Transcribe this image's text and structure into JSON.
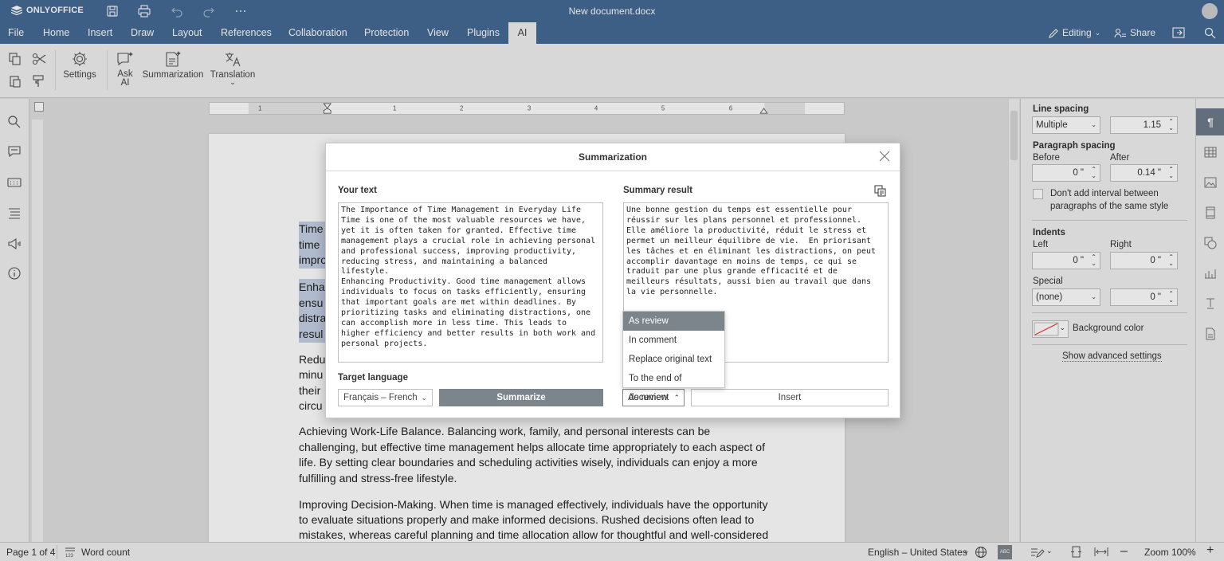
{
  "app": {
    "name": "ONLYOFFICE",
    "doc_title": "New document.docx"
  },
  "menu": {
    "tabs": [
      "File",
      "Home",
      "Insert",
      "Draw",
      "Layout",
      "References",
      "Collaboration",
      "Protection",
      "View",
      "Plugins",
      "AI"
    ],
    "active_tab": "AI",
    "editing_label": "Editing",
    "share_label": "Share"
  },
  "toolbar": {
    "settings": "Settings",
    "ask_ai_1": "Ask",
    "ask_ai_2": "AI",
    "summarization": "Summarization",
    "translation": "Translation"
  },
  "ruler": {
    "numbers": [
      "1",
      "1",
      "2",
      "3",
      "4",
      "5",
      "6"
    ]
  },
  "document": {
    "highlight_fragments": [
      "Time",
      "time",
      "impro",
      "Enha",
      "ensu",
      "distra",
      "resul"
    ],
    "partial_lines": [
      "Redu",
      "minu",
      "their",
      "circu"
    ],
    "paragraphs": [
      [
        "Achieving Work-Life Balance. Balancing work, family, and personal interests can be",
        "challenging, but effective time management helps allocate time appropriately to each aspect of",
        "life. By setting clear boundaries and scheduling activities wisely, individuals can enjoy a more",
        "fulfilling and stress-free lifestyle."
      ],
      [
        "Improving Decision-Making. When time is managed effectively, individuals have the opportunity",
        "to evaluate situations properly and make informed decisions. Rushed decisions often lead to",
        "mistakes, whereas careful planning and time allocation allow for thoughtful and well-considered"
      ]
    ]
  },
  "dialog": {
    "title": "Summarization",
    "your_text_label": "Your text",
    "your_text": "The Importance of Time Management in Everyday Life\nTime is one of the most valuable resources we have,\nyet it is often taken for granted. Effective time\nmanagement plays a crucial role in achieving personal\nand professional success, improving productivity,\nreducing stress, and maintaining a balanced\nlifestyle.\nEnhancing Productivity. Good time management allows\nindividuals to focus on tasks efficiently, ensuring\nthat important goals are met within deadlines. By\nprioritizing tasks and eliminating distractions, one\ncan accomplish more in less time. This leads to\nhigher efficiency and better results in both work and\npersonal projects.",
    "summary_label": "Summary result",
    "summary_text": "Une bonne gestion du temps est essentielle pour\nréussir sur les plans personnel et professionnel.\nElle améliore la productivité, réduit le stress et\npermet un meilleur équilibre de vie.  En priorisant\nles tâches et en éliminant les distractions, on peut\naccomplir davantage en moins de temps, ce qui se\ntraduit par une plus grande efficacité et de\nmeilleurs résultats, aussi bien au travail que dans\nla vie personnelle.",
    "target_language_label": "Target language",
    "target_language_value": "Français – French",
    "summarize_button": "Summarize",
    "insert_mode_value": "As review",
    "insert_button": "Insert",
    "insert_options": [
      "As review",
      "In comment",
      "Replace original text",
      "To the end of document"
    ]
  },
  "right_panel": {
    "line_spacing_label": "Line spacing",
    "line_spacing_mode": "Multiple",
    "line_spacing_value": "1.15",
    "paragraph_spacing_label": "Paragraph spacing",
    "before_label": "Before",
    "after_label": "After",
    "before_value": "0 \"",
    "after_value": "0.14 \"",
    "dont_add_interval_1": "Don't add interval between",
    "dont_add_interval_2": "paragraphs of the same style",
    "indents_label": "Indents",
    "left_label": "Left",
    "right_label": "Right",
    "left_value": "0 \"",
    "right_value": "0 \"",
    "special_label": "Special",
    "special_mode": "(none)",
    "special_value": "0 \"",
    "background_color_label": "Background color",
    "show_advanced": "Show advanced settings"
  },
  "status": {
    "page": "Page 1 of 4",
    "word_count": "Word count",
    "language": "English – United States",
    "zoom": "Zoom 100%"
  }
}
